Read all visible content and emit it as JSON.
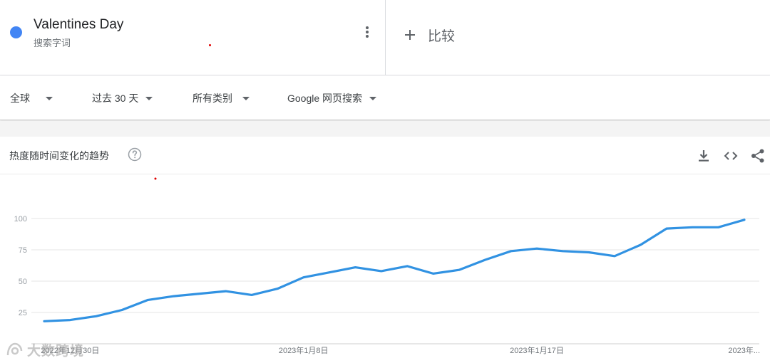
{
  "term": {
    "title": "Valentines Day",
    "subtitle": "搜索字词",
    "color": "#4285f4",
    "menu_icon": "more-vert-icon"
  },
  "compare": {
    "label": "比较",
    "icon": "plus-icon"
  },
  "filters": [
    {
      "label": "全球"
    },
    {
      "label": "过去 30 天"
    },
    {
      "label": "所有类别"
    },
    {
      "label": "Google 网页搜索"
    }
  ],
  "chart_header": {
    "title": "热度随时间变化的趋势",
    "icons": [
      "help-icon",
      "download-icon",
      "embed-code-icon",
      "share-icon"
    ]
  },
  "watermark": {
    "text": "大数跨境",
    "icon": "watermark-logo-icon"
  },
  "chart_data": {
    "type": "line",
    "series": [
      {
        "color": "#3192e2",
        "values": [
          18,
          19,
          22,
          27,
          35,
          38,
          40,
          42,
          39,
          44,
          53,
          57,
          61,
          58,
          62,
          56,
          59,
          67,
          74,
          76,
          74,
          73,
          70,
          79,
          92,
          93,
          93,
          99
        ]
      }
    ],
    "y_ticks": [
      25,
      50,
      75,
      100
    ],
    "ylim": [
      0,
      100
    ],
    "x_tick_labels": [
      {
        "index": 1,
        "label": "2022年12月30日"
      },
      {
        "index": 10,
        "label": "2023年1月8日"
      },
      {
        "index": 19,
        "label": "2023年1月17日"
      },
      {
        "index": 28,
        "label": "2023年..."
      }
    ],
    "grid": true
  }
}
